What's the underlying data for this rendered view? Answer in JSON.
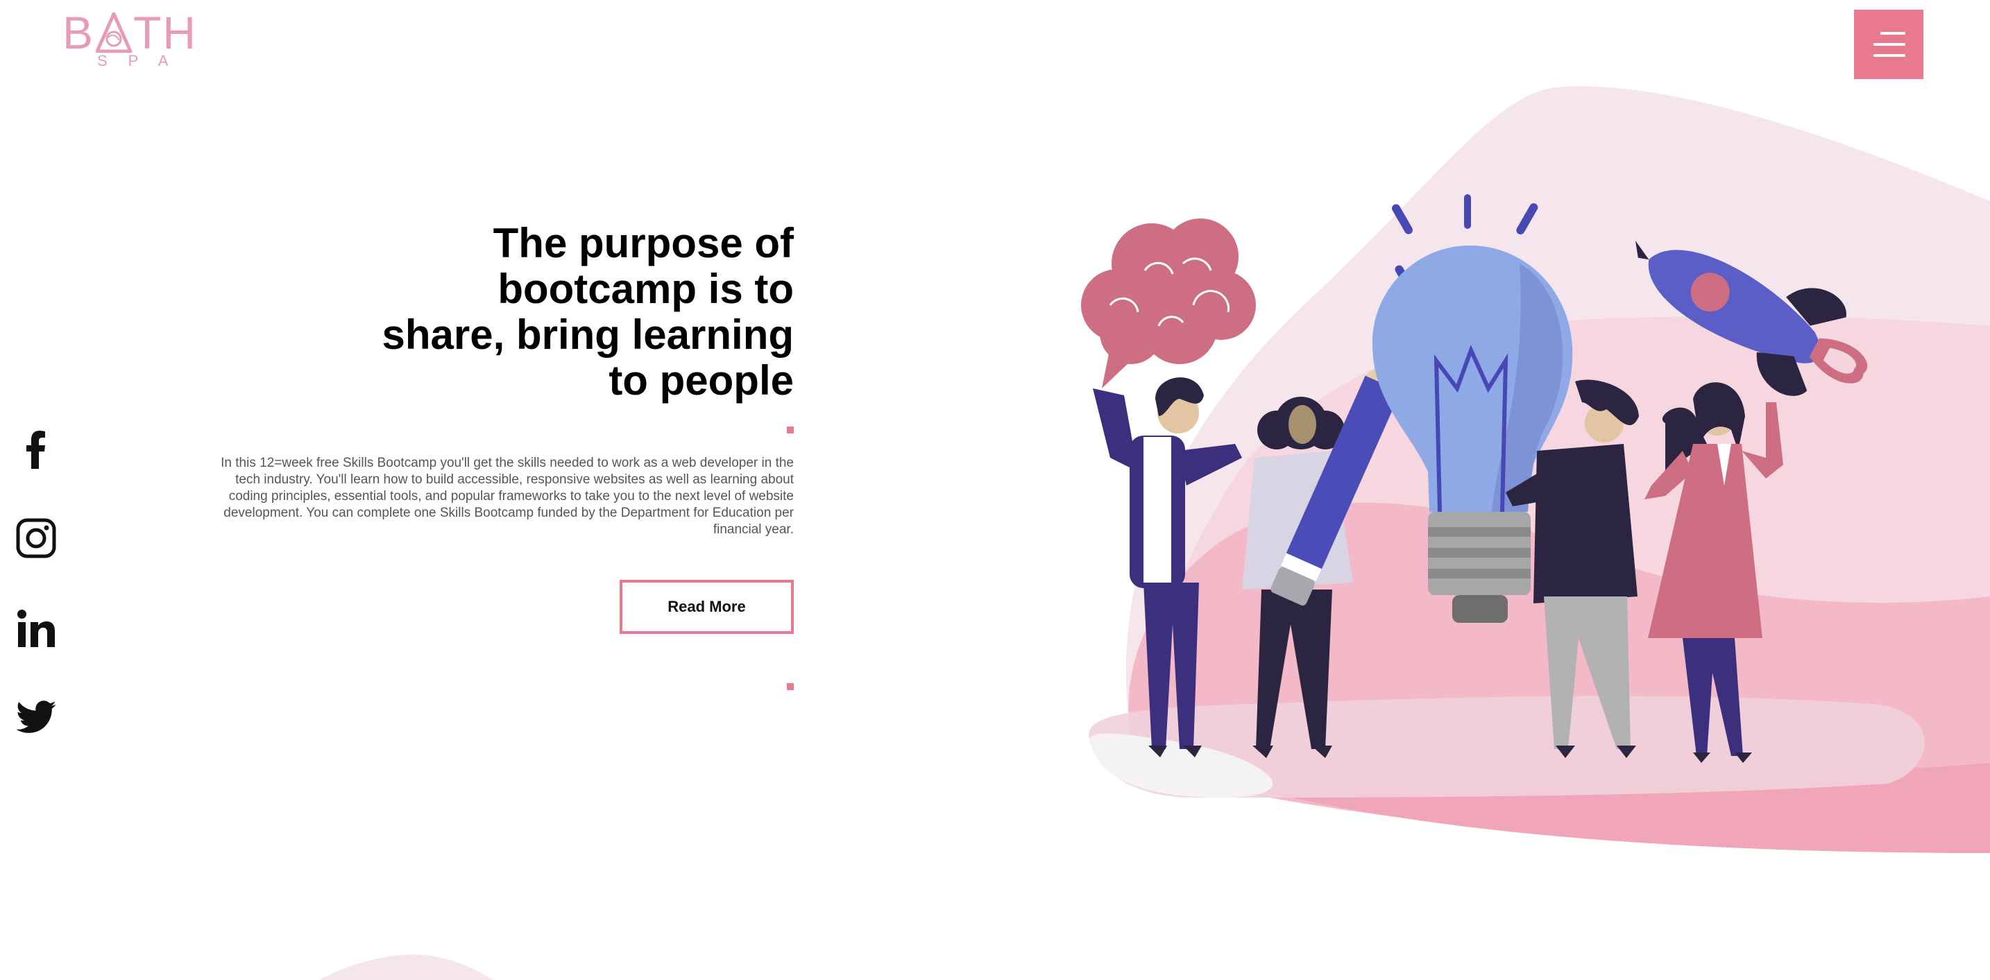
{
  "logo": {
    "main_left": "B",
    "main_right": "TH",
    "sub": "SPA"
  },
  "menu": {
    "icon": "hamburger-icon",
    "color": "#e8798f"
  },
  "social": [
    {
      "name": "facebook",
      "icon": "facebook-icon"
    },
    {
      "name": "instagram",
      "icon": "instagram-icon"
    },
    {
      "name": "linkedin",
      "icon": "linkedin-icon"
    },
    {
      "name": "twitter",
      "icon": "twitter-icon"
    }
  ],
  "hero": {
    "title_lines": [
      "The purpose of",
      "bootcamp is to",
      "share, bring learning",
      "to people"
    ],
    "body": "In this 12=week free Skills Bootcamp you'll get the skills needed to work as a web developer in the tech industry. You'll learn how to build accessible, responsive websites as well as learning about coding principles, essential tools, and popular frameworks to take you to the next level of website development. You can complete one Skills Bootcamp funded by the Department for Education per financial year.",
    "button_label": "Read More"
  },
  "colors": {
    "accent": "#e8798f",
    "logo": "#e89bb5",
    "title": "#000000",
    "body": "#555555"
  }
}
